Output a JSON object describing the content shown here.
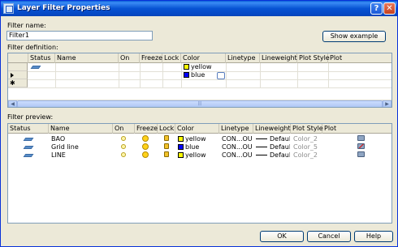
{
  "window": {
    "title": "Layer Filter Properties",
    "help_glyph": "?",
    "close_glyph": "✕"
  },
  "filter_name": {
    "label": "Filter name:",
    "value": "Filter1",
    "show_example_label": "Show example"
  },
  "definition": {
    "label": "Filter definition:",
    "columns": [
      "Status",
      "Name",
      "On",
      "Freeze",
      "Lock",
      "Color",
      "Linetype",
      "Lineweight",
      "Plot Style",
      "Plot"
    ],
    "rows": [
      {
        "color_name": "yellow",
        "color_hex": "#ffff00",
        "has_status_icon": true
      },
      {
        "color_name": "blue",
        "color_hex": "#0000ff",
        "has_status_icon": false
      }
    ],
    "new_row_marker": "✱"
  },
  "preview": {
    "label": "Filter preview:",
    "columns": [
      "Status",
      "Name",
      "On",
      "Freeze",
      "Lock",
      "Color",
      "Linetype",
      "Lineweight",
      "Plot Style",
      "Plot"
    ],
    "rows": [
      {
        "name": "BAO",
        "color": "yellow",
        "color_hex": "#ffff00",
        "linetype": "CON...OUS",
        "lineweight": "Default",
        "plot_style": "Color_2",
        "plot_icon": "printer-icon"
      },
      {
        "name": "Grid line",
        "color": "blue",
        "color_hex": "#0000ff",
        "linetype": "CON...OUS",
        "lineweight": "Default",
        "plot_style": "Color_5",
        "plot_icon": "no-plot-printer-icon"
      },
      {
        "name": "LINE",
        "color": "yellow",
        "color_hex": "#ffff00",
        "linetype": "CON...OUS",
        "lineweight": "Default",
        "plot_style": "Color_2",
        "plot_icon": "printer-icon"
      }
    ]
  },
  "buttons": {
    "ok": "OK",
    "cancel": "Cancel",
    "help": "Help"
  },
  "colors": {
    "title_bar": "#0753d3",
    "dialog_bg": "#ece9d8"
  }
}
